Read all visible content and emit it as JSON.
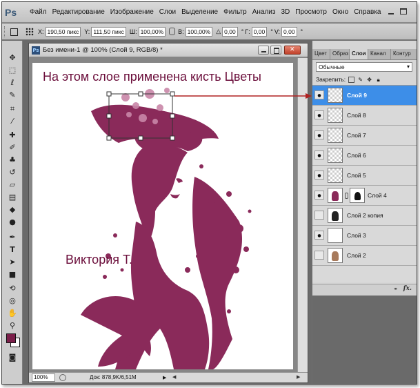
{
  "app": {
    "logo": "Ps",
    "menu": [
      "Файл",
      "Редактирование",
      "Изображение",
      "Слои",
      "Выделение",
      "Фильтр",
      "Анализ",
      "3D",
      "Просмотр",
      "Окно",
      "Справка"
    ]
  },
  "options_bar": {
    "x_label": "X:",
    "x_value": "190,50 пикс",
    "y_label": "Y:",
    "y_value": "111,50 пикс",
    "w_label": "Ш:",
    "w_value": "100,00%",
    "h_label": "В:",
    "h_value": "100,00%",
    "angle_value": "0,00",
    "angle_unit": "°",
    "hskew_label": "Г:",
    "hskew_value": "0,00",
    "hskew_unit": "°",
    "vskew_label": "V:",
    "vskew_value": "0,00",
    "vskew_unit": "°"
  },
  "document": {
    "title": "Без имени-1 @ 100% (Слой 9, RGB/8) *",
    "zoom": "100%",
    "status": "Док: 878,9K/6,51M"
  },
  "annotations": {
    "main": "На этом слое применена кисть Цветы",
    "author": "Виктория Т."
  },
  "panel": {
    "tabs": [
      "Цвет",
      "Образ",
      "Слои",
      "Канал",
      "Контур"
    ],
    "active_tab": "Слои",
    "blend_mode": "Обычные",
    "lock_label": "Закрепить:",
    "layers": [
      {
        "name": "Слой 9",
        "visible": true,
        "selected": true,
        "thumb": "transparent"
      },
      {
        "name": "Слой 8",
        "visible": true,
        "selected": false,
        "thumb": "transparent"
      },
      {
        "name": "Слой 7",
        "visible": true,
        "selected": false,
        "thumb": "transparent"
      },
      {
        "name": "Слой 6",
        "visible": true,
        "selected": false,
        "thumb": "transparent"
      },
      {
        "name": "Слой 5",
        "visible": true,
        "selected": false,
        "thumb": "transparent"
      },
      {
        "name": "Слой 4",
        "visible": true,
        "selected": false,
        "thumb": "art",
        "mask": true
      },
      {
        "name": "Слой 2 копия",
        "visible": false,
        "selected": false,
        "thumb": "bw"
      },
      {
        "name": "Слой 3",
        "visible": true,
        "selected": false,
        "thumb": "white"
      },
      {
        "name": "Слой 2",
        "visible": false,
        "selected": false,
        "thumb": "color"
      }
    ],
    "bottom_icons": [
      "link-icon",
      "fx-icon"
    ],
    "fx_label": "fx."
  },
  "colors": {
    "foreground": "#7b1f4a",
    "background": "#ffffff",
    "art": "#8a2a5a",
    "annotation": "#6b0e3b",
    "selection": "#3d8ee8",
    "arrow": "#b02020"
  },
  "tools": [
    "move-tool-icon",
    "marquee-tool-icon",
    "lasso-tool-icon",
    "quick-selection-tool-icon",
    "crop-tool-icon",
    "eyedropper-tool-icon",
    "healing-brush-tool-icon",
    "brush-tool-icon",
    "clone-stamp-tool-icon",
    "history-brush-tool-icon",
    "eraser-tool-icon",
    "gradient-tool-icon",
    "blur-tool-icon",
    "dodge-tool-icon",
    "pen-tool-icon",
    "type-tool-icon",
    "path-selection-tool-icon",
    "shape-tool-icon",
    "3d-rotate-tool-icon",
    "3d-orbit-tool-icon",
    "hand-tool-icon",
    "zoom-tool-icon"
  ]
}
